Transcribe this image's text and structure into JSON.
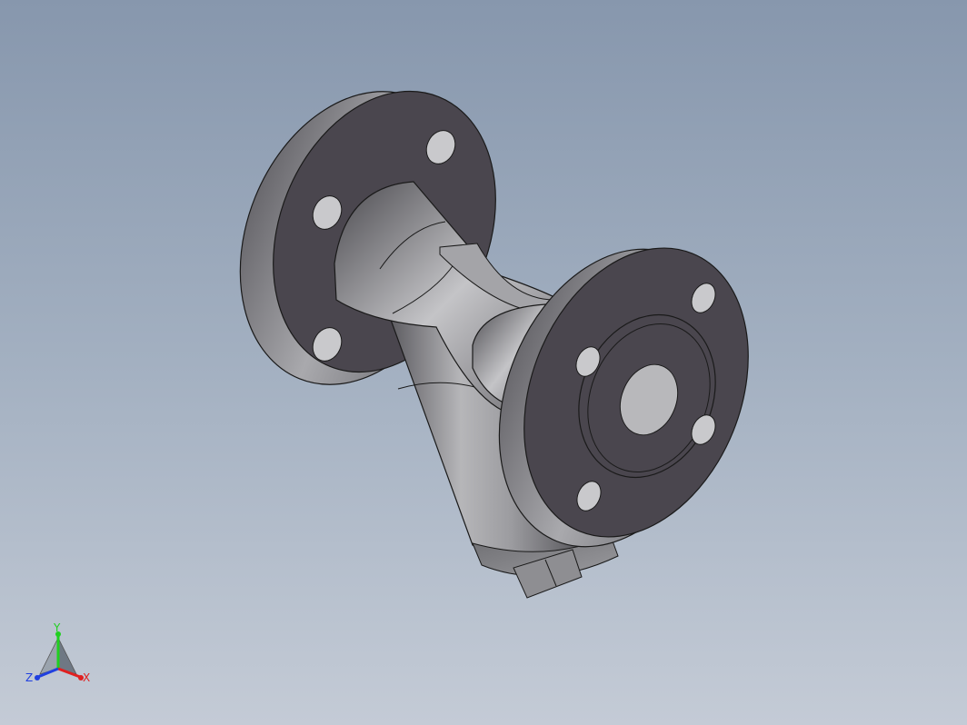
{
  "viewport": {
    "background_top": "#8797ad",
    "background_bottom": "#c4cbd6",
    "model": "y-strainer-flanged",
    "model_color": "#8a8a8e",
    "face_color": "#4a464e"
  },
  "triad": {
    "x_label": "X",
    "y_label": "Y",
    "z_label": "Z",
    "x_color": "#e02020",
    "y_color": "#20d020",
    "z_color": "#2040e0"
  }
}
